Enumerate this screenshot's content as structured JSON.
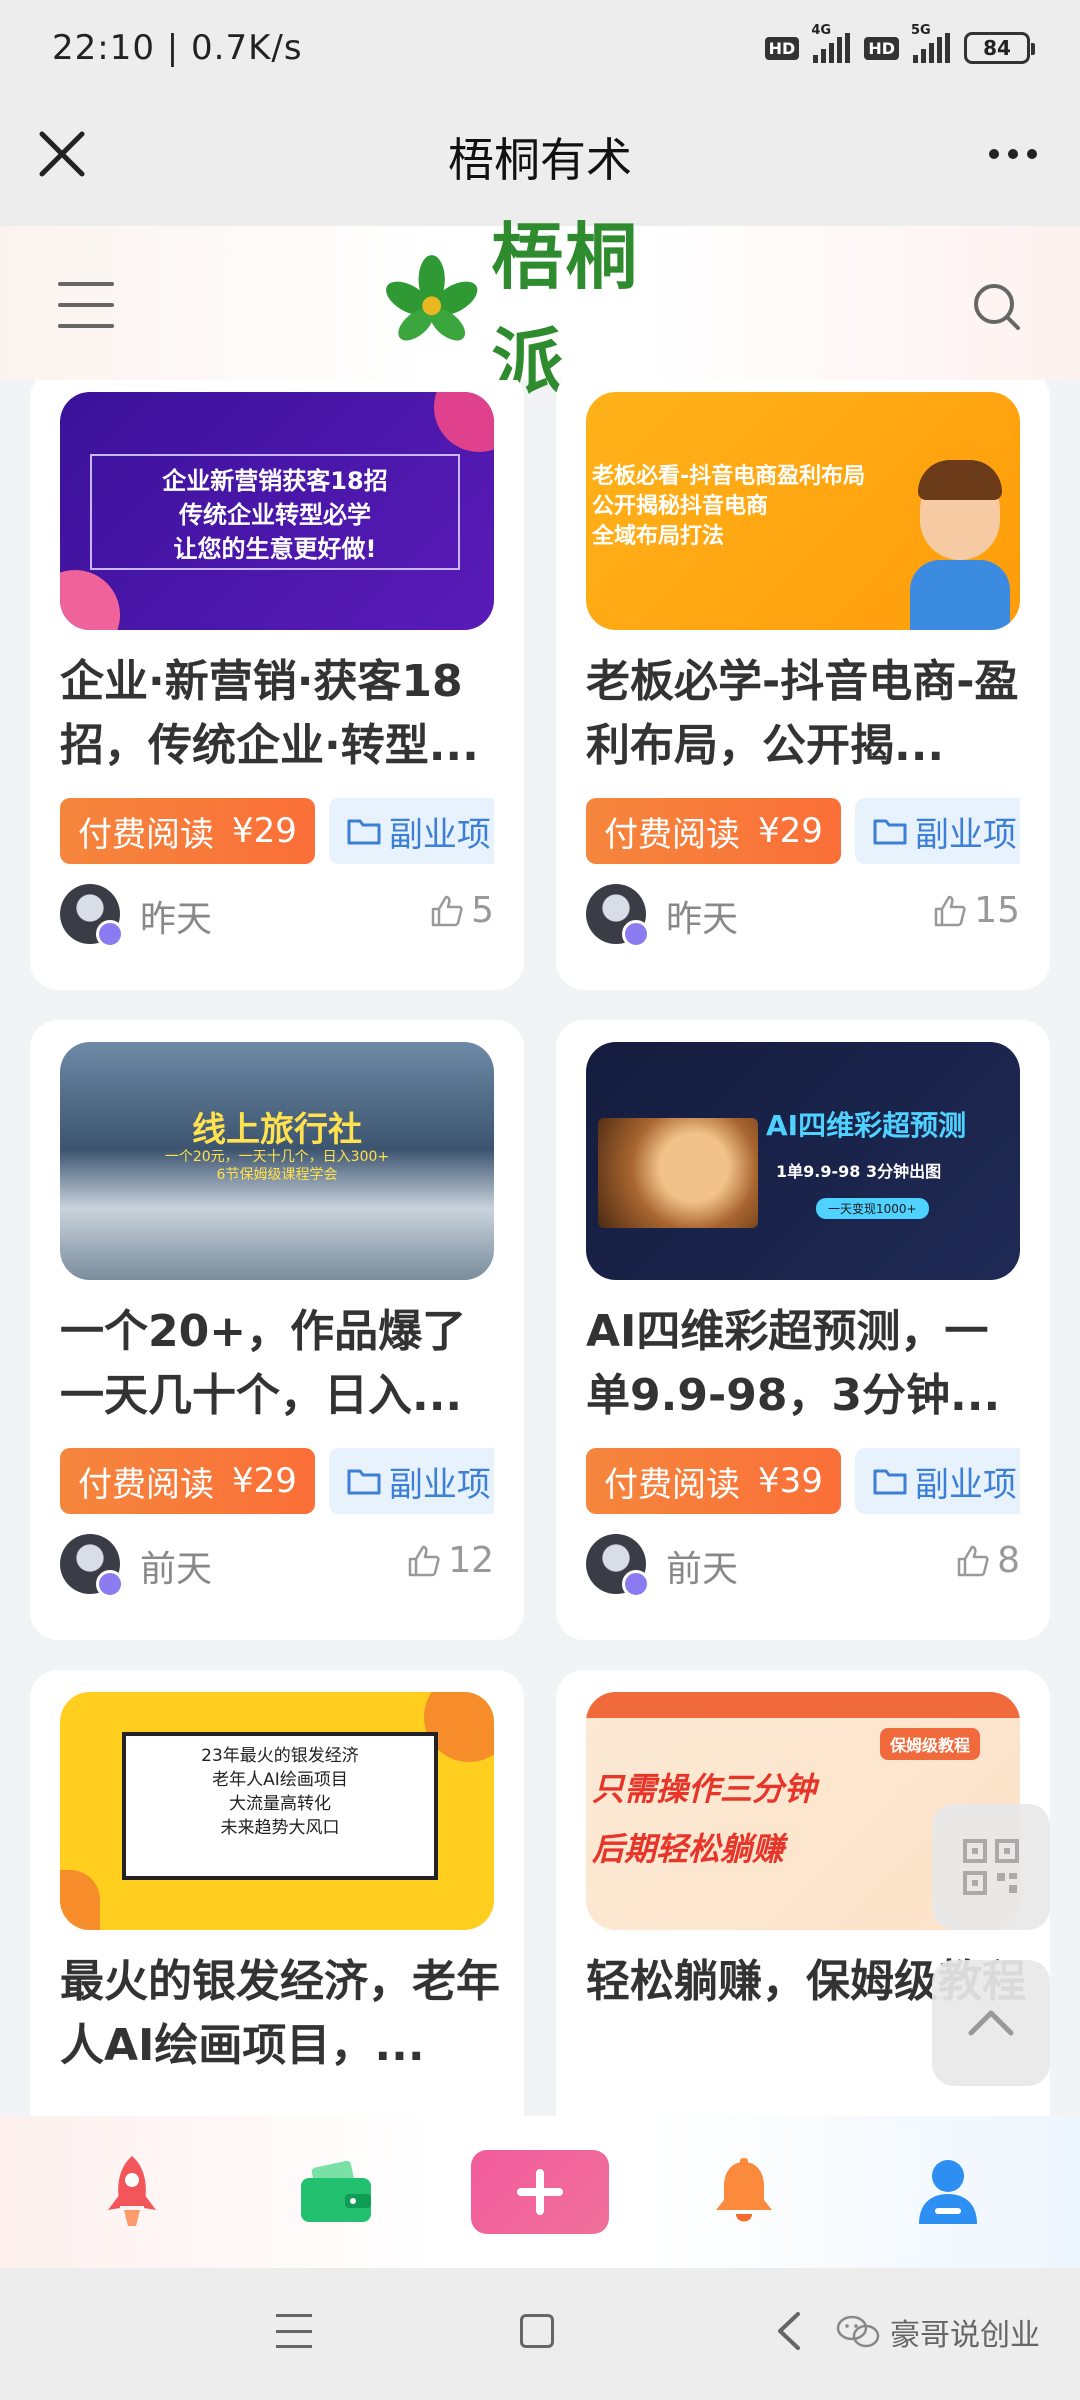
{
  "status_bar": {
    "time_speed": "22:10 | 0.7K/s",
    "hd1": "HD",
    "net1": "4G",
    "hd2": "HD",
    "net2": "5G",
    "battery": "84"
  },
  "nav_bar": {
    "title": "梧桐有术"
  },
  "app_header": {
    "logo_text": "梧桐派"
  },
  "cards": [
    {
      "title": "企业·新营销·获客18招，传统企业·转型...",
      "paid_label": "付费阅读",
      "price": "¥29",
      "category": "副业项",
      "time": "昨天",
      "likes": "5",
      "thumb_lines": [
        "企业新营销获客18招",
        "传统企业转型必学",
        "让您的生意更好做!"
      ]
    },
    {
      "title": "老板必学-抖音电商-盈利布局，公开揭...",
      "paid_label": "付费阅读",
      "price": "¥29",
      "category": "副业项",
      "time": "昨天",
      "likes": "15",
      "thumb_lines": [
        "老板必看-抖音电商盈利布局",
        "公开揭秘抖音电商",
        "全域布局打法"
      ]
    },
    {
      "title": "一个20+，作品爆了一天几十个，日入...",
      "paid_label": "付费阅读",
      "price": "¥29",
      "category": "副业项",
      "time": "前天",
      "likes": "12",
      "thumb_lines": [
        "线上旅行社",
        "一个20元，一天十几个，日入300+",
        "6节保姆级课程学会"
      ]
    },
    {
      "title": "AI四维彩超预测，一单9.9-98，3分钟...",
      "paid_label": "付费阅读",
      "price": "¥39",
      "category": "副业项",
      "time": "前天",
      "likes": "8",
      "thumb_lines": [
        "AI四维彩超预测",
        "1单9.9-98 3分钟出图",
        "一天变现1000+"
      ]
    },
    {
      "title": "最火的银发经济，老年人AI绘画项目，...",
      "thumb_lines": [
        "23年最火的银发经济",
        "老年人AI绘画项目",
        "大流量高转化",
        "未来趋势大风口"
      ]
    },
    {
      "title": "轻松躺赚，保姆级教程",
      "thumb_lines": [
        "保姆级教程",
        "只需操作三分钟",
        "后期轻松躺赚"
      ]
    }
  ],
  "watermark": "豪哥说创业",
  "colors": {
    "paid_tag": "#f97a3a",
    "category_tag_bg": "#e8f2fd",
    "category_tag_text": "#3b7fd6",
    "logo_green": "#2e8b2e",
    "plus_button": "#f25b9c"
  }
}
